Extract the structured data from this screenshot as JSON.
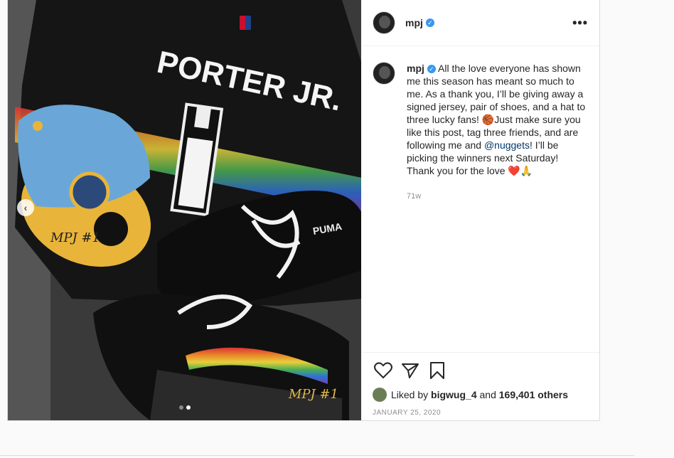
{
  "post": {
    "username": "mpj",
    "verified_mark": "✓",
    "more_label": "•••",
    "caption_text": " All the love everyone has shown me this season has meant so much to me. As a thank you, I’ll be giving away a signed jersey, pair of shoes, and a hat to three lucky fans! 🏀Just make sure you like this post, tag three friends, and are following me and ",
    "caption_mention": "@nuggets",
    "caption_end": "! I’ll be picking the winners next Saturday! Thank you for the love ❤️🙏",
    "time_ago": "71w",
    "liked_by_prefix": "Liked by ",
    "liked_by_user": "bigwug_4",
    "liked_and": " and ",
    "likes_count": "169,401 others",
    "date": "JANUARY 25, 2020"
  },
  "photo": {
    "jersey_name": "PORTER JR.",
    "jersey_number": "1",
    "signature": "MPJ #1",
    "shoe_text": "PUMA"
  },
  "carousel": {
    "prev_label": "‹",
    "slides": 2,
    "active_slide": 2
  },
  "icons": [
    "heart-icon",
    "share-icon",
    "bookmark-icon",
    "chevron-left-icon"
  ]
}
